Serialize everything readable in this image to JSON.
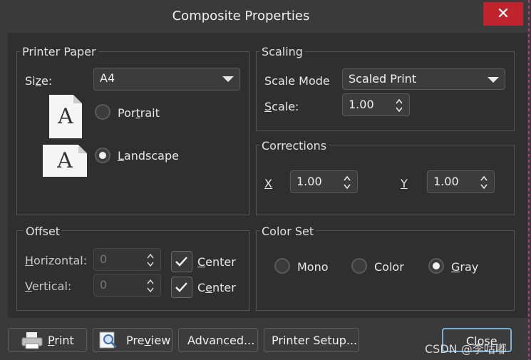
{
  "window": {
    "title": "Composite Properties",
    "close_glyph": "✕"
  },
  "printer_paper": {
    "title": "Printer Paper",
    "size_label": "Size:",
    "size_value": "A4",
    "paper_glyph": "A",
    "portrait_label": "Portrait",
    "landscape_label": "Landscape",
    "selected": "Landscape"
  },
  "scaling": {
    "title": "Scaling",
    "mode_label": "Scale Mode",
    "mode_value": "Scaled Print",
    "scale_label": "Scale:",
    "scale_value": "1.00"
  },
  "corrections": {
    "title": "Corrections",
    "x_label": "X",
    "x_value": "1.00",
    "y_label": "Y",
    "y_value": "1.00"
  },
  "offset": {
    "title": "Offset",
    "horizontal_label": "Horizontal:",
    "horizontal_value": "0",
    "vertical_label": "Vertical:",
    "vertical_value": "0",
    "center_label": "Center",
    "center_h_checked": true,
    "center_v_checked": true
  },
  "color_set": {
    "title": "Color Set",
    "mono_label": "Mono",
    "color_label": "Color",
    "gray_label": "Gray",
    "selected": "Gray"
  },
  "buttons": {
    "print": "Print",
    "preview": "Preview",
    "advanced": "Advanced...",
    "printer_setup": "Printer Setup...",
    "close": "Close"
  },
  "watermark": "CSDN @李咕嘟",
  "colors": {
    "background": "#2f2f2f",
    "titlebar": "#3a3a3a",
    "close_red": "#c0232c",
    "focus_border": "#7ab0d8"
  }
}
